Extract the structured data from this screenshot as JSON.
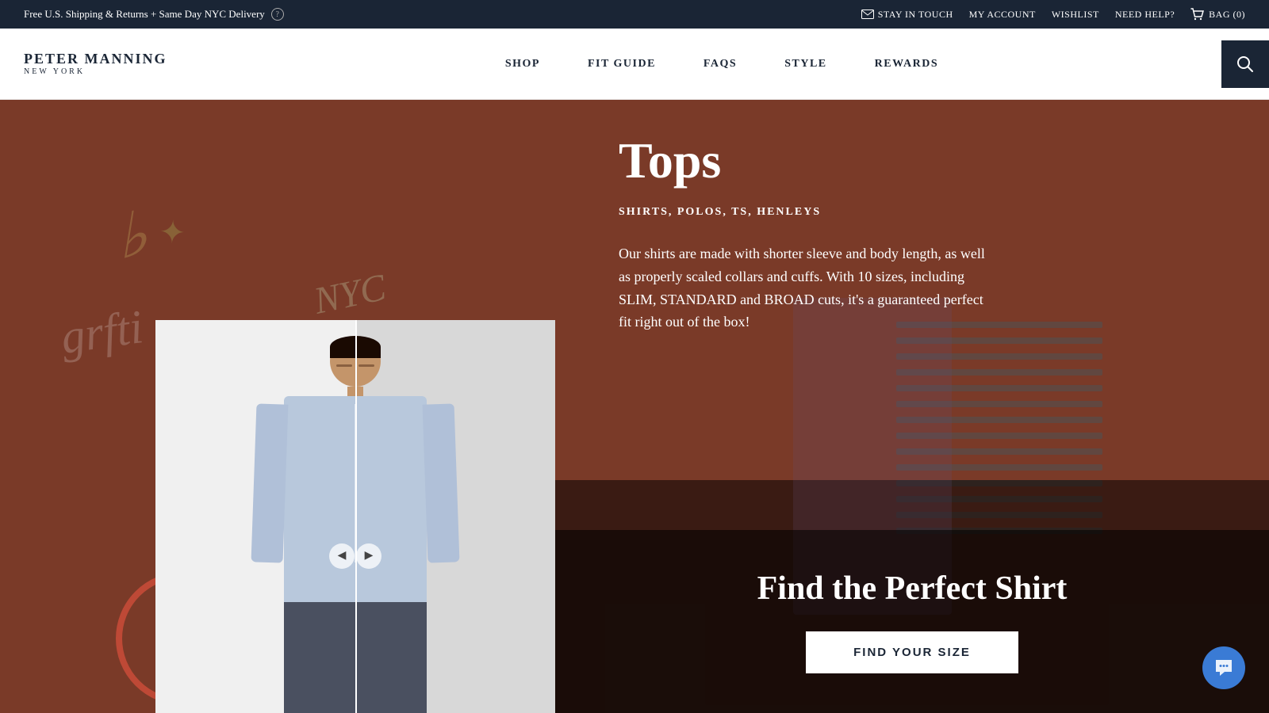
{
  "announcement": {
    "text": "Free U.S. Shipping & Returns + Same Day NYC Delivery",
    "help_icon": "?",
    "stay_in_touch": "STAY IN TOUCH",
    "my_account": "MY ACCOUNT",
    "wishlist": "WISHLIST",
    "need_help": "NEED HELP?",
    "bag": "BAG (0)"
  },
  "logo": {
    "line1": "PETER MANNING",
    "line2": "NEW YORK"
  },
  "nav": {
    "items": [
      {
        "label": "SHOP",
        "id": "shop"
      },
      {
        "label": "FIT GUIDE",
        "id": "fit-guide"
      },
      {
        "label": "FAQS",
        "id": "faqs"
      },
      {
        "label": "STYLE",
        "id": "style"
      },
      {
        "label": "REWARDS",
        "id": "rewards"
      }
    ]
  },
  "hero": {
    "title": "Tops",
    "subtitle": "SHIRTS, POLOS, TS, HENLEYS",
    "description": "Our shirts are made with shorter sleeve and body length, as well as properly scaled collars and cuffs. With 10 sizes, including SLIM, STANDARD and BROAD cuts, it's a guaranteed perfect fit right out of the box!",
    "cta_title": "Find the Perfect Shirt",
    "cta_button": "FIND YOUR SIZE"
  },
  "search": {
    "icon": "🔍"
  },
  "chat": {
    "icon": "💬"
  }
}
